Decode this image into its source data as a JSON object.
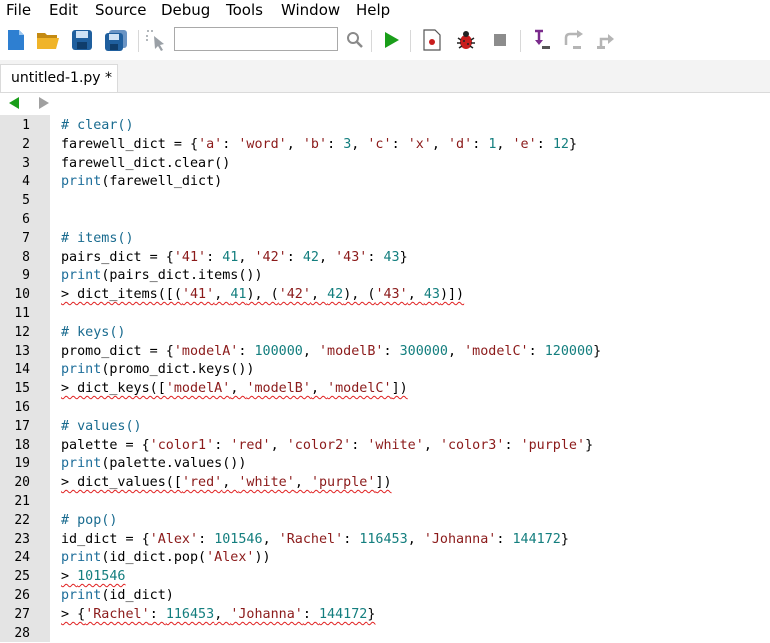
{
  "menu": {
    "items": [
      "File",
      "Edit",
      "Source",
      "Debug",
      "Tools",
      "Window",
      "Help"
    ]
  },
  "toolbar": {
    "search_value": "",
    "icons": [
      "new-file-icon",
      "open-folder-icon",
      "save-icon",
      "save-all-icon",
      "select-pointer-icon",
      "search-icon",
      "run-icon",
      "debug-stop-icon",
      "bug-icon",
      "stop-icon",
      "step-in-icon",
      "step-over-icon",
      "step-out-icon"
    ]
  },
  "tabs": [
    {
      "label": "untitled-1.py *"
    }
  ],
  "editor": {
    "line_numbers": [
      "1",
      "2",
      "3",
      "4",
      "5",
      "6",
      "7",
      "8",
      "9",
      "10",
      "11",
      "12",
      "13",
      "14",
      "15",
      "16",
      "17",
      "18",
      "19",
      "20",
      "21",
      "22",
      "23",
      "24",
      "25",
      "26",
      "27",
      "28"
    ],
    "lines": [
      [
        {
          "t": "# clear()",
          "c": "comment"
        }
      ],
      [
        {
          "t": "farewell_dict = {"
        },
        {
          "t": "'a'",
          "c": "str"
        },
        {
          "t": ": "
        },
        {
          "t": "'word'",
          "c": "str"
        },
        {
          "t": ", "
        },
        {
          "t": "'b'",
          "c": "str"
        },
        {
          "t": ": "
        },
        {
          "t": "3",
          "c": "num"
        },
        {
          "t": ", "
        },
        {
          "t": "'c'",
          "c": "str"
        },
        {
          "t": ": "
        },
        {
          "t": "'x'",
          "c": "str"
        },
        {
          "t": ", "
        },
        {
          "t": "'d'",
          "c": "str"
        },
        {
          "t": ": "
        },
        {
          "t": "1",
          "c": "num"
        },
        {
          "t": ", "
        },
        {
          "t": "'e'",
          "c": "str"
        },
        {
          "t": ": "
        },
        {
          "t": "12",
          "c": "num"
        },
        {
          "t": "}"
        }
      ],
      [
        {
          "t": "farewell_dict.clear()"
        }
      ],
      [
        {
          "t": "print",
          "c": "builtin"
        },
        {
          "t": "(farewell_dict)"
        }
      ],
      [],
      [],
      [
        {
          "t": "# items()",
          "c": "comment"
        }
      ],
      [
        {
          "t": "pairs_dict = {"
        },
        {
          "t": "'41'",
          "c": "str"
        },
        {
          "t": ": "
        },
        {
          "t": "41",
          "c": "num"
        },
        {
          "t": ", "
        },
        {
          "t": "'42'",
          "c": "str"
        },
        {
          "t": ": "
        },
        {
          "t": "42",
          "c": "num"
        },
        {
          "t": ", "
        },
        {
          "t": "'43'",
          "c": "str"
        },
        {
          "t": ": "
        },
        {
          "t": "43",
          "c": "num"
        },
        {
          "t": "}"
        }
      ],
      [
        {
          "t": "print",
          "c": "builtin"
        },
        {
          "t": "(pairs_dict.items())"
        }
      ],
      [
        {
          "t": "> dict_items([(",
          "s": 1
        },
        {
          "t": "'41'",
          "c": "str",
          "s": 1
        },
        {
          "t": ", ",
          "s": 1
        },
        {
          "t": "41",
          "c": "num",
          "s": 1
        },
        {
          "t": "), (",
          "s": 1
        },
        {
          "t": "'42'",
          "c": "str",
          "s": 1
        },
        {
          "t": ", ",
          "s": 1
        },
        {
          "t": "42",
          "c": "num",
          "s": 1
        },
        {
          "t": "), (",
          "s": 1
        },
        {
          "t": "'43'",
          "c": "str",
          "s": 1
        },
        {
          "t": ", ",
          "s": 1
        },
        {
          "t": "43",
          "c": "num",
          "s": 1
        },
        {
          "t": ")])",
          "s": 1
        }
      ],
      [],
      [
        {
          "t": "# keys()",
          "c": "comment"
        }
      ],
      [
        {
          "t": "promo_dict = {"
        },
        {
          "t": "'modelA'",
          "c": "str"
        },
        {
          "t": ": "
        },
        {
          "t": "100000",
          "c": "num"
        },
        {
          "t": ", "
        },
        {
          "t": "'modelB'",
          "c": "str"
        },
        {
          "t": ": "
        },
        {
          "t": "300000",
          "c": "num"
        },
        {
          "t": ", "
        },
        {
          "t": "'modelC'",
          "c": "str"
        },
        {
          "t": ": "
        },
        {
          "t": "120000",
          "c": "num"
        },
        {
          "t": "}"
        }
      ],
      [
        {
          "t": "print",
          "c": "builtin"
        },
        {
          "t": "(promo_dict.keys())"
        }
      ],
      [
        {
          "t": "> dict_keys([",
          "s": 1
        },
        {
          "t": "'modelA'",
          "c": "str",
          "s": 1
        },
        {
          "t": ", ",
          "s": 1
        },
        {
          "t": "'modelB'",
          "c": "str",
          "s": 1
        },
        {
          "t": ", ",
          "s": 1
        },
        {
          "t": "'modelC'",
          "c": "str",
          "s": 1
        },
        {
          "t": "])",
          "s": 1
        }
      ],
      [],
      [
        {
          "t": "# values()",
          "c": "comment"
        }
      ],
      [
        {
          "t": "palette = {"
        },
        {
          "t": "'color1'",
          "c": "str"
        },
        {
          "t": ": "
        },
        {
          "t": "'red'",
          "c": "str"
        },
        {
          "t": ", "
        },
        {
          "t": "'color2'",
          "c": "str"
        },
        {
          "t": ": "
        },
        {
          "t": "'white'",
          "c": "str"
        },
        {
          "t": ", "
        },
        {
          "t": "'color3'",
          "c": "str"
        },
        {
          "t": ": "
        },
        {
          "t": "'purple'",
          "c": "str"
        },
        {
          "t": "}"
        }
      ],
      [
        {
          "t": "print",
          "c": "builtin"
        },
        {
          "t": "(palette.values())"
        }
      ],
      [
        {
          "t": "> dict_values([",
          "s": 1
        },
        {
          "t": "'red'",
          "c": "str",
          "s": 1
        },
        {
          "t": ", ",
          "s": 1
        },
        {
          "t": "'white'",
          "c": "str",
          "s": 1
        },
        {
          "t": ", ",
          "s": 1
        },
        {
          "t": "'purple'",
          "c": "str",
          "s": 1
        },
        {
          "t": "])",
          "s": 1
        }
      ],
      [],
      [
        {
          "t": "# pop()",
          "c": "comment"
        }
      ],
      [
        {
          "t": "id_dict = {"
        },
        {
          "t": "'Alex'",
          "c": "str"
        },
        {
          "t": ": "
        },
        {
          "t": "101546",
          "c": "num"
        },
        {
          "t": ", "
        },
        {
          "t": "'Rachel'",
          "c": "str"
        },
        {
          "t": ": "
        },
        {
          "t": "116453",
          "c": "num"
        },
        {
          "t": ", "
        },
        {
          "t": "'Johanna'",
          "c": "str"
        },
        {
          "t": ": "
        },
        {
          "t": "144172",
          "c": "num"
        },
        {
          "t": "}"
        }
      ],
      [
        {
          "t": "print",
          "c": "builtin"
        },
        {
          "t": "(id_dict.pop("
        },
        {
          "t": "'Alex'",
          "c": "str"
        },
        {
          "t": "))"
        }
      ],
      [
        {
          "t": "> ",
          "s": 1
        },
        {
          "t": "101546",
          "c": "num",
          "s": 1
        }
      ],
      [
        {
          "t": "print",
          "c": "builtin"
        },
        {
          "t": "(id_dict)"
        }
      ],
      [
        {
          "t": "> {",
          "s": 1
        },
        {
          "t": "'Rachel'",
          "c": "str",
          "s": 1
        },
        {
          "t": ": ",
          "s": 1
        },
        {
          "t": "116453",
          "c": "num",
          "s": 1
        },
        {
          "t": ", ",
          "s": 1
        },
        {
          "t": "'Johanna'",
          "c": "str",
          "s": 1
        },
        {
          "t": ": ",
          "s": 1
        },
        {
          "t": "144172",
          "c": "num",
          "s": 1
        },
        {
          "t": "}",
          "s": 1
        }
      ],
      []
    ]
  },
  "colors": {
    "comment": "#196b8f",
    "string": "#8b1a1a",
    "number": "#137e7e",
    "builtin": "#1e6e9a",
    "gutter": "#e4e4e4",
    "run_green": "#1a9e1a",
    "squiggle": "#e02020"
  }
}
